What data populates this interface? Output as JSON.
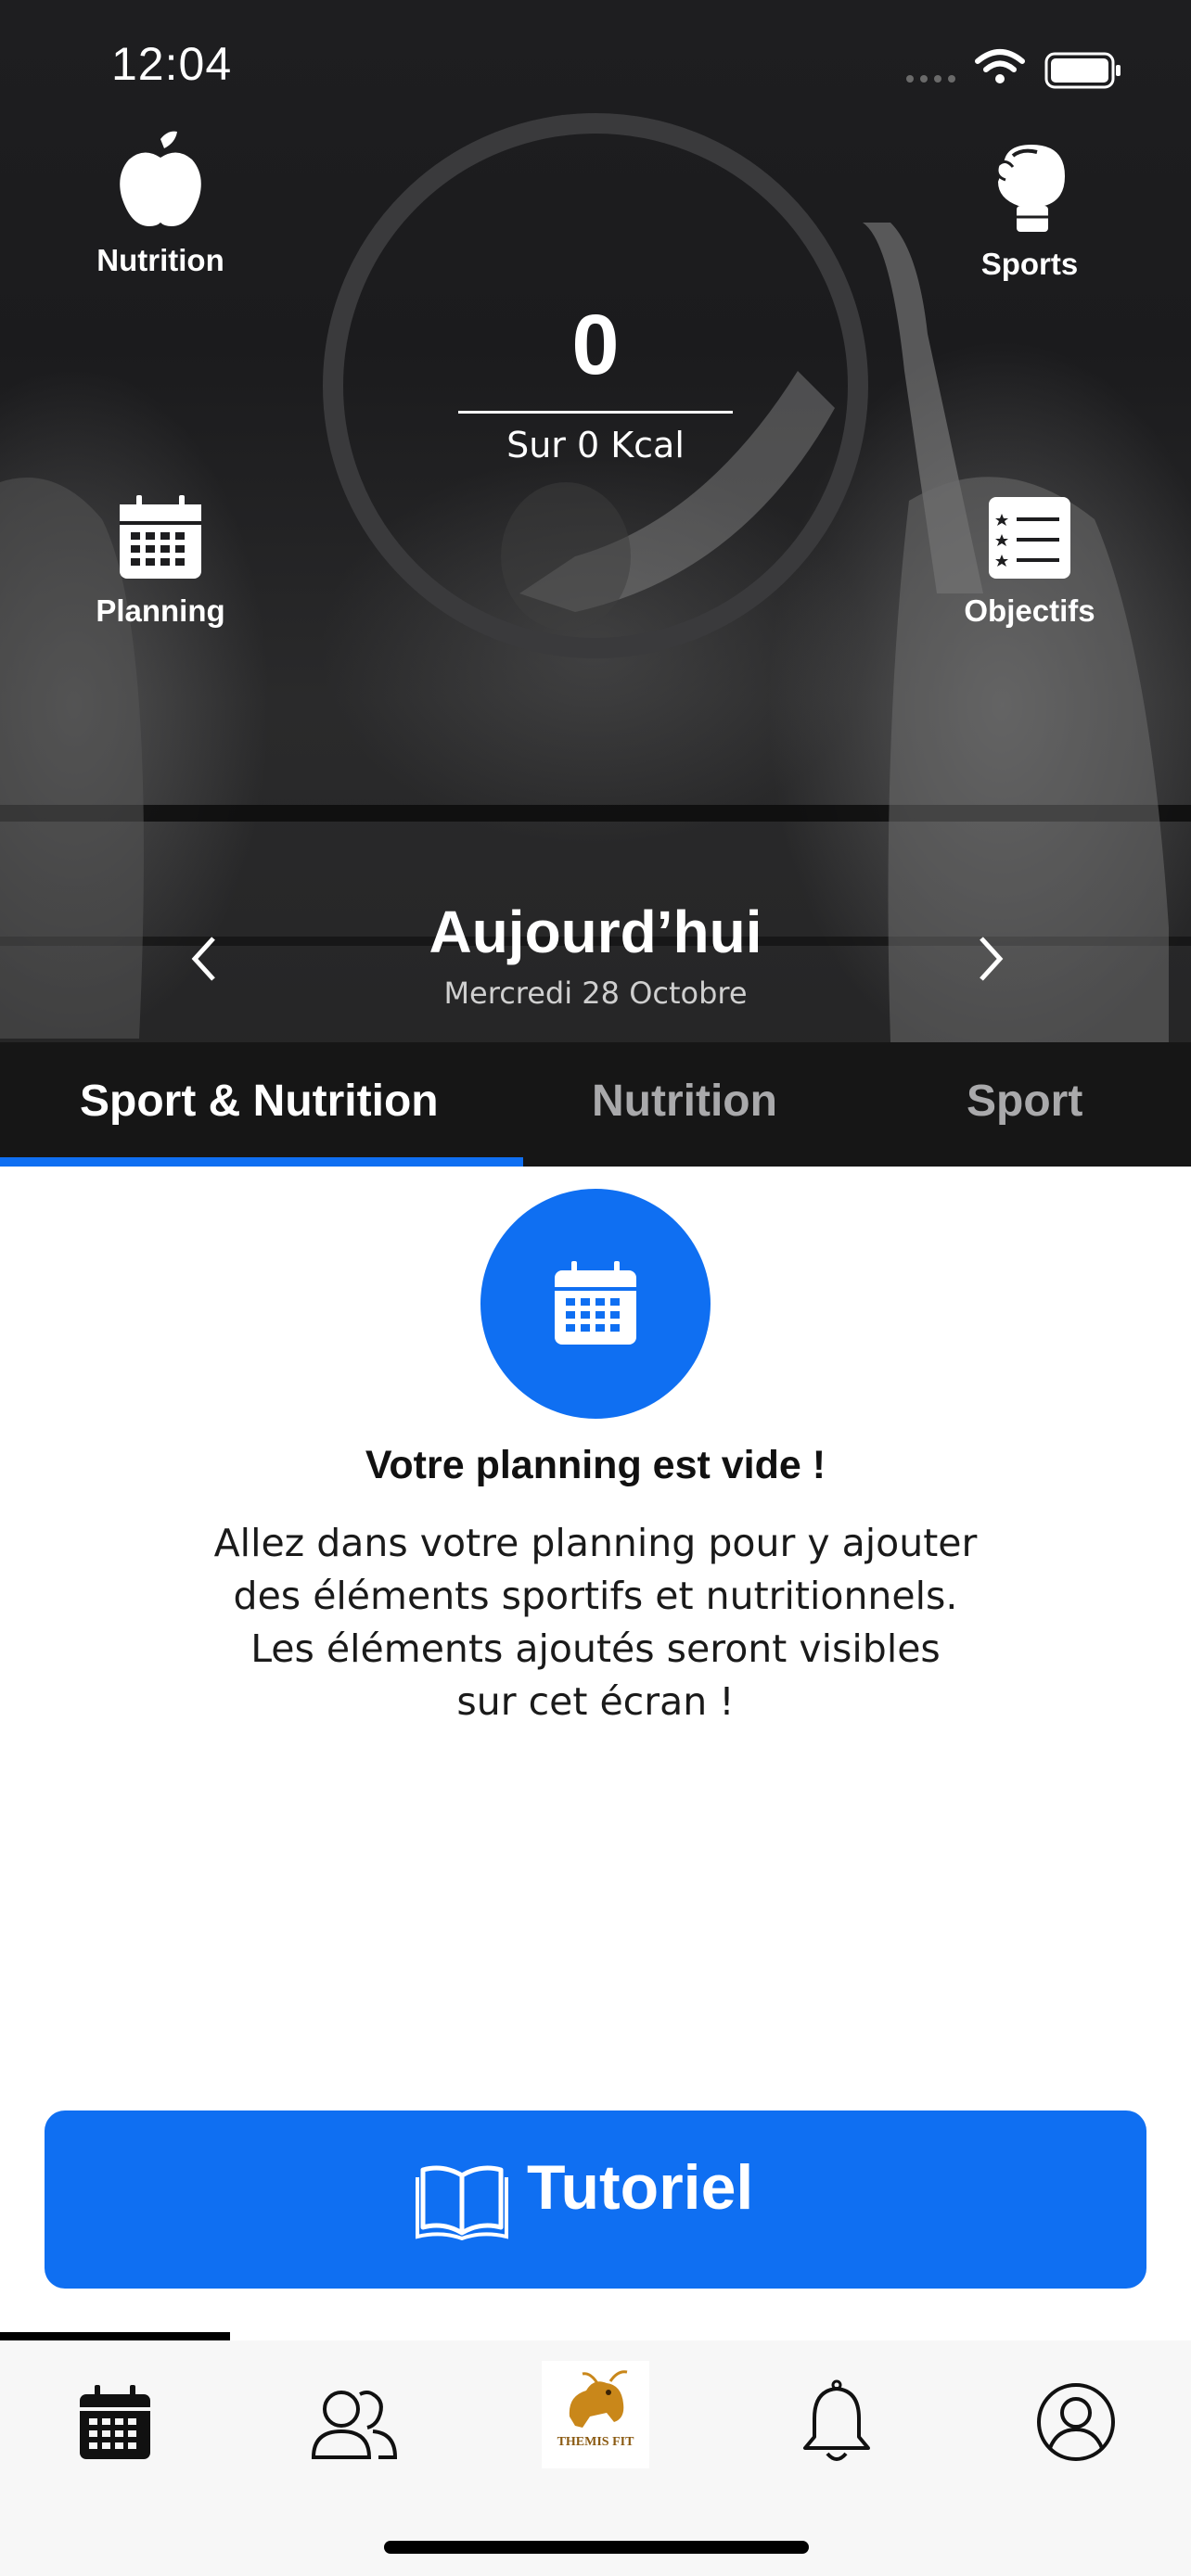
{
  "status_bar": {
    "time": "12:04"
  },
  "hero": {
    "shortcuts": {
      "nutrition": "Nutrition",
      "sports": "Sports",
      "planning": "Planning",
      "objectives": "Objectifs"
    },
    "calories": {
      "value": "0",
      "subtitle": "Sur 0 Kcal",
      "progress": 0
    },
    "date": {
      "title": "Aujourd’hui",
      "subtitle": "Mercredi 28 Octobre"
    }
  },
  "tabs": [
    {
      "label": "Sport & Nutrition",
      "active": true
    },
    {
      "label": "Nutrition",
      "active": false
    },
    {
      "label": "Sport",
      "active": false
    }
  ],
  "empty_state": {
    "title": "Votre planning est vide !",
    "lines": [
      "Allez dans votre planning pour y ajouter",
      "des éléments sportifs et nutritionnels.",
      "Les éléments ajoutés seront visibles",
      "sur cet écran !"
    ]
  },
  "tutorial_button": {
    "label": "Tutoriel"
  },
  "bottom_nav": {
    "items": [
      "calendar-icon",
      "people-icon",
      "themis-fit-logo",
      "bell-icon",
      "profile-icon"
    ],
    "active_index": 0,
    "logo_text": "THEMIS FIT"
  },
  "colors": {
    "accent": "#0f6ff2",
    "hero_bg": "#1e1e20",
    "tab_inactive": "#a9a9ab"
  }
}
